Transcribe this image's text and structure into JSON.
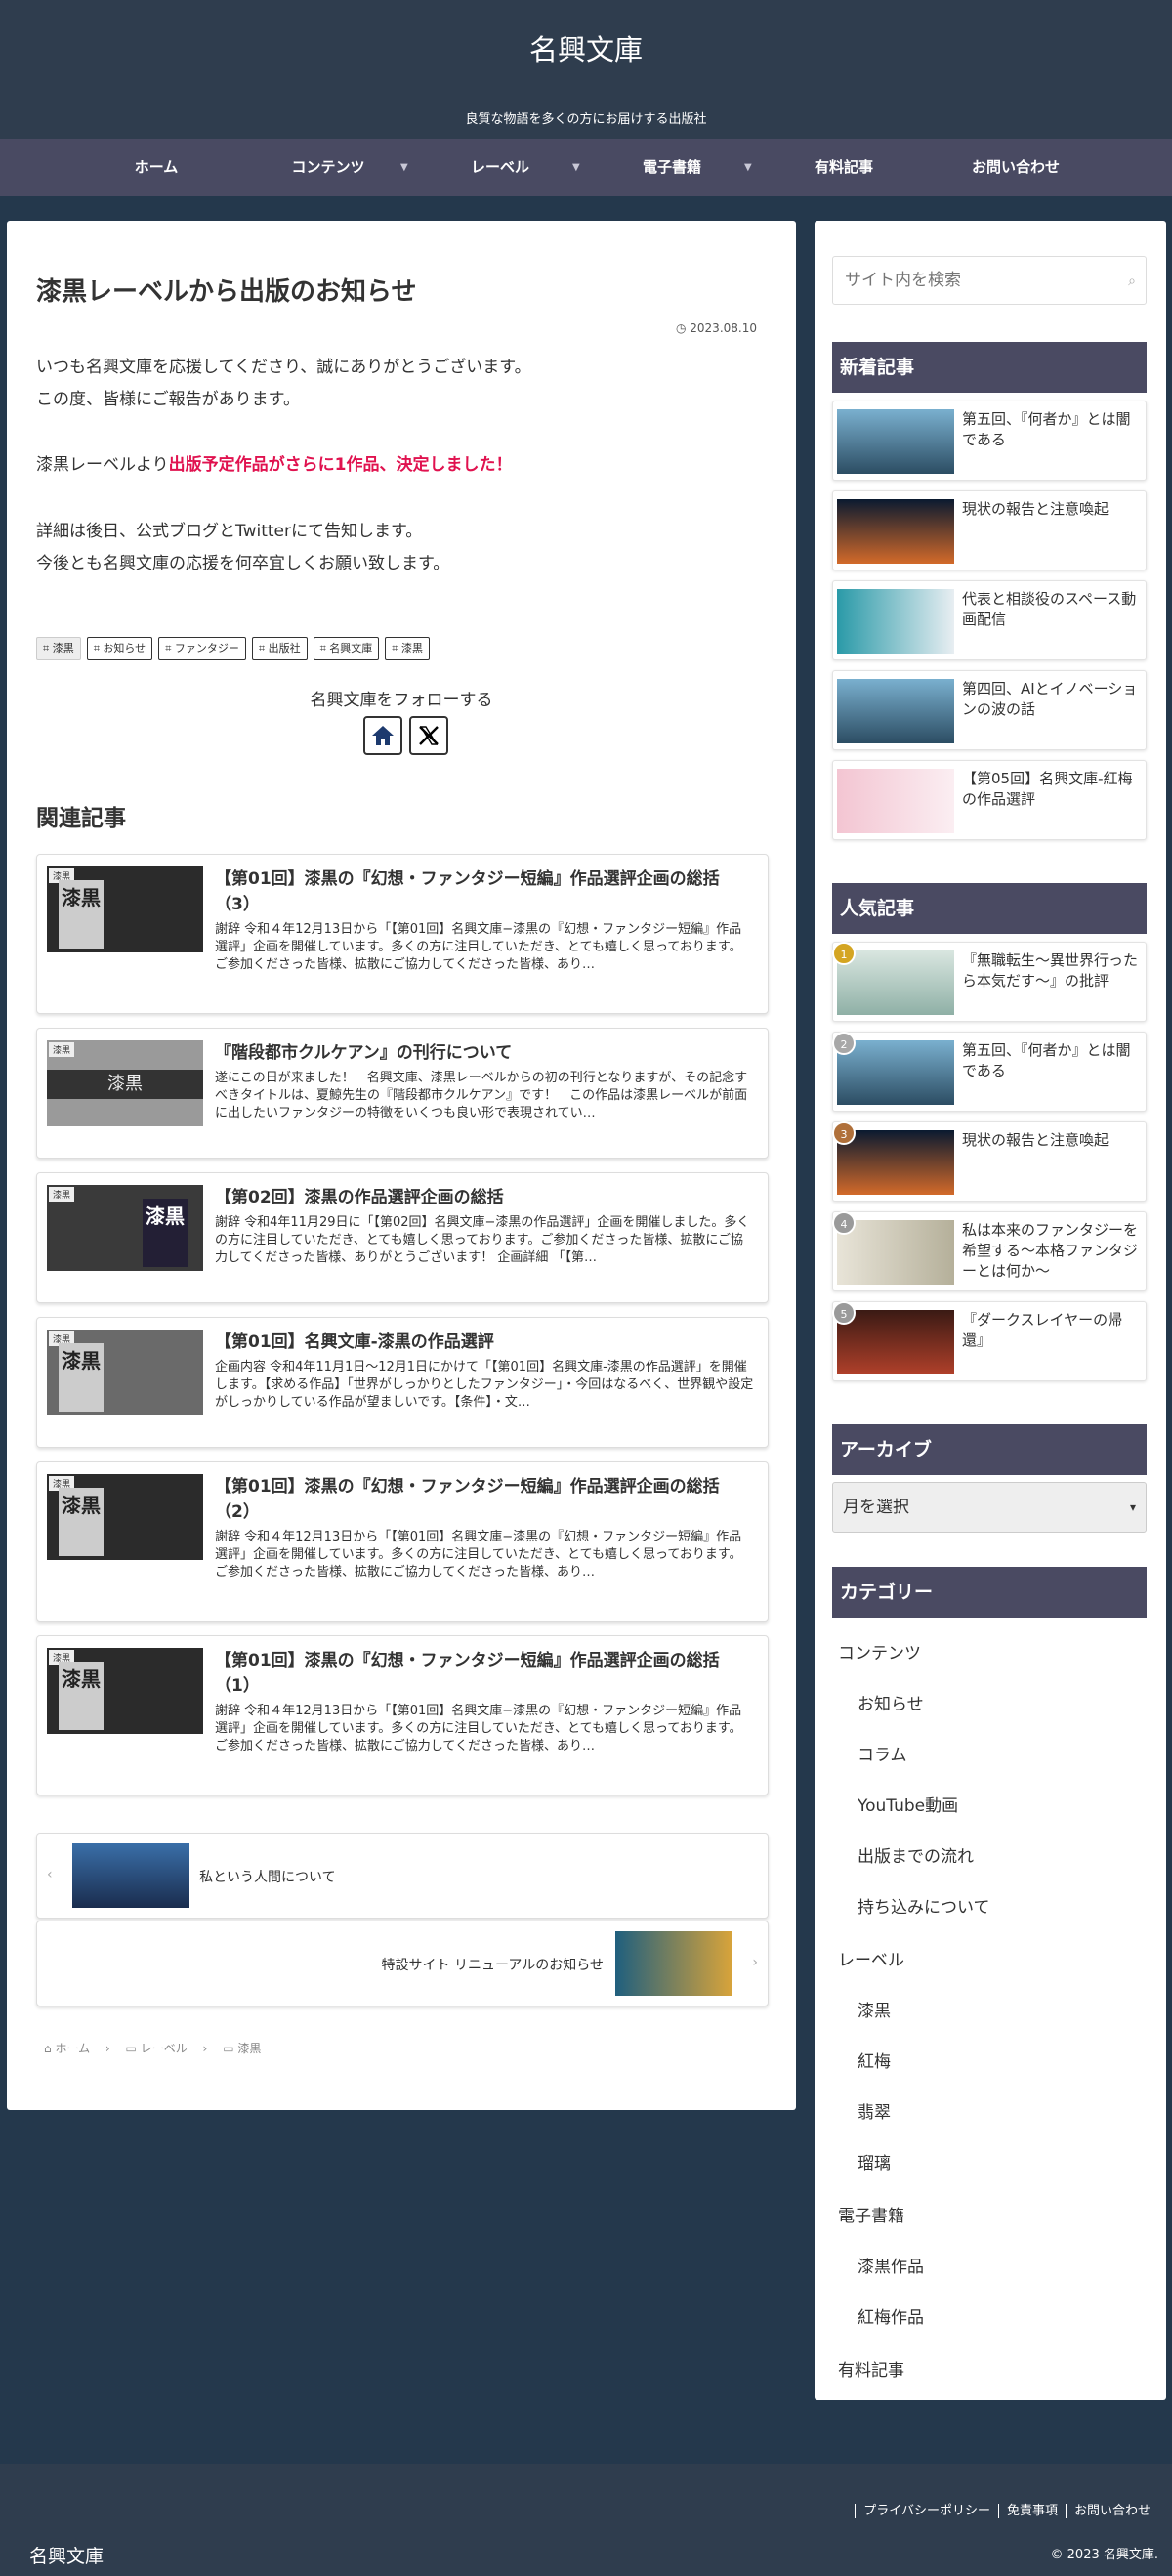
{
  "header": {
    "title": "名興文庫",
    "tagline": "良質な物語を多くの方にお届けする出版社"
  },
  "nav": [
    {
      "label": "ホーム",
      "caret": false
    },
    {
      "label": "コンテンツ",
      "caret": true
    },
    {
      "label": "レーベル",
      "caret": true
    },
    {
      "label": "電子書籍",
      "caret": true
    },
    {
      "label": "有料記事",
      "caret": false
    },
    {
      "label": "お問い合わせ",
      "caret": false
    }
  ],
  "article": {
    "title": "漆黒レーベルから出版のお知らせ",
    "date": "2023.08.10",
    "p1a": "いつも名興文庫を応援してくださり、誠にありがとうございます。",
    "p1b": "この度、皆様にご報告があります。",
    "p2_prefix": "漆黒レーベルより",
    "p2_highlight": "出版予定作品がさらに1作品、決定しました！",
    "p3a": "詳細は後日、公式ブログとTwitterにて告知します。",
    "p3b": "今後とも名興文庫の応援を何卒宜しくお願い致します。",
    "tags": [
      "漆黒",
      "お知らせ",
      "ファンタジー",
      "出版社",
      "名興文庫",
      "漆黒"
    ],
    "follow_label": "名興文庫をフォローする"
  },
  "related": {
    "title": "関連記事",
    "cards": [
      {
        "label": "漆黒",
        "kanji": "漆黒",
        "title": "【第01回】漆黒の『幻想・ファンタジー短編』作品選評企画の総括（3）",
        "snippet": "謝辞 令和４年12月13日から「【第01回】名興文庫−漆黒の『幻想・ファンタジー短編』作品選評」企画を開催しています。多くの方に注目していただき、とても嬉しく思っております。ご参加くださった皆様、拡散にご協力してくださった皆様、あり…"
      },
      {
        "label": "漆黒",
        "kanji": "漆黒",
        "title": "『階段都市クルケアン』の刊行について",
        "snippet": "遂にこの日が来ました！　名興文庫、漆黒レーベルからの初の刊行となりますが、その記念すべきタイトルは、夏鯨先生の『階段都市クルケアン』です！　この作品は漆黒レーベルが前面に出したいファンタジーの特徴をいくつも良い形で表現されてい…"
      },
      {
        "label": "漆黒",
        "kanji": "漆黒",
        "title": "【第02回】漆黒の作品選評企画の総括",
        "snippet": "謝辞 令和4年11月29日に「【第02回】名興文庫−漆黒の作品選評」企画を開催しました。多くの方に注目していただき、とても嬉しく思っております。ご参加くださった皆様、拡散にご協力してくださった皆様、ありがとうございます！ 企画詳細 「【第…"
      },
      {
        "label": "漆黒",
        "kanji": "漆黒",
        "title": "【第01回】名興文庫-漆黒の作品選評",
        "snippet": "企画内容 令和4年11月1日〜12月1日にかけて「【第01回】名興文庫-漆黒の作品選評」を開催します。【求める作品】「世界がしっかりとしたファンタジー」・今回はなるべく、世界観や設定がしっかりしている作品が望ましいです。【条件】・文…"
      },
      {
        "label": "漆黒",
        "kanji": "漆黒",
        "title": "【第01回】漆黒の『幻想・ファンタジー短編』作品選評企画の総括（2）",
        "snippet": "謝辞 令和４年12月13日から「【第01回】名興文庫−漆黒の『幻想・ファンタジー短編』作品選評」企画を開催しています。多くの方に注目していただき、とても嬉しく思っております。ご参加くださった皆様、拡散にご協力してくださった皆様、あり…"
      },
      {
        "label": "漆黒",
        "kanji": "漆黒",
        "title": "【第01回】漆黒の『幻想・ファンタジー短編』作品選評企画の総括（1）",
        "snippet": "謝辞 令和４年12月13日から「【第01回】名興文庫−漆黒の『幻想・ファンタジー短編』作品選評」企画を開催しています。多くの方に注目していただき、とても嬉しく思っております。ご参加くださった皆様、拡散にご協力してくださった皆様、あり…"
      }
    ]
  },
  "pager": {
    "prev": "私という人間について",
    "next": "特設サイト リニューアルのお知らせ"
  },
  "breadcrumb": [
    "ホーム",
    "レーベル",
    "漆黒"
  ],
  "sidebar": {
    "search_placeholder": "サイト内を検索",
    "new_title": "新着記事",
    "new_items": [
      "第五回、『何者か』とは闇である",
      "現状の報告と注意喚起",
      "代表と相談役のスペース動画配信",
      "第四回、AIとイノベーションの波の話",
      "【第05回】名興文庫-紅梅の作品選評"
    ],
    "popular_title": "人気記事",
    "popular_items": [
      {
        "rank": "1",
        "text": "『無職転生〜異世界行ったら本気だす〜』の批評"
      },
      {
        "rank": "2",
        "text": "第五回、『何者か』とは闇である"
      },
      {
        "rank": "3",
        "text": "現状の報告と注意喚起"
      },
      {
        "rank": "4",
        "text": "私は本来のファンタジーを希望する〜本格ファンタジーとは何か〜"
      },
      {
        "rank": "5",
        "text": "『ダークスレイヤーの帰還』"
      }
    ],
    "archive_title": "アーカイブ",
    "archive_select": "月を選択",
    "category_title": "カテゴリー",
    "categories": [
      {
        "label": "コンテンツ",
        "child": false
      },
      {
        "label": "お知らせ",
        "child": true
      },
      {
        "label": "コラム",
        "child": true
      },
      {
        "label": "YouTube動画",
        "child": true
      },
      {
        "label": "出版までの流れ",
        "child": true
      },
      {
        "label": "持ち込みについて",
        "child": true
      },
      {
        "label": "レーベル",
        "child": false
      },
      {
        "label": "漆黒",
        "child": true
      },
      {
        "label": "紅梅",
        "child": true
      },
      {
        "label": "翡翠",
        "child": true
      },
      {
        "label": "瑠璃",
        "child": true
      },
      {
        "label": "電子書籍",
        "child": false
      },
      {
        "label": "漆黒作品",
        "child": true
      },
      {
        "label": "紅梅作品",
        "child": true
      },
      {
        "label": "有料記事",
        "child": false
      }
    ]
  },
  "footer": {
    "links": [
      "プライバシーポリシー",
      "免責事項",
      "お問い合わせ"
    ],
    "copyright": "© 2023 名興文庫.",
    "logo": "名興文庫"
  },
  "colors": {
    "accent_red": "#e0124f",
    "nav_bg": "#494a62",
    "widget_title_bg": "#4a4a62",
    "body_bg": "#24384c"
  }
}
